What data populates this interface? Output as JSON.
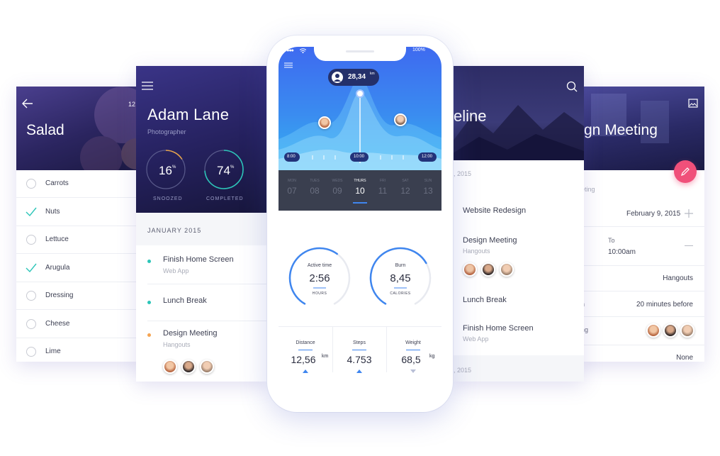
{
  "salad": {
    "title": "Salad",
    "header_number": "12",
    "items": [
      {
        "label": "Carrots",
        "checked": false
      },
      {
        "label": "Nuts",
        "checked": true
      },
      {
        "label": "Lettuce",
        "checked": false
      },
      {
        "label": "Arugula",
        "checked": true
      },
      {
        "label": "Dressing",
        "checked": false
      },
      {
        "label": "Cheese",
        "checked": false
      },
      {
        "label": "Lime",
        "checked": false
      }
    ]
  },
  "profile": {
    "name": "Adam Lane",
    "role": "Photographer",
    "stats": [
      {
        "value": "16",
        "unit": "%",
        "label": "SNOOZED",
        "fraction": 0.16
      },
      {
        "value": "74",
        "unit": "%",
        "label": "COMPLETED",
        "fraction": 0.74
      }
    ],
    "month": "JANUARY 2015",
    "events": [
      {
        "title": "Finish Home Screen",
        "subtitle": "Web App",
        "color": "#2cc5b8"
      },
      {
        "title": "Lunch Break",
        "subtitle": "",
        "color": "#2cc5b8"
      },
      {
        "title": "Design Meeting",
        "subtitle": "Hangouts",
        "color": "#f5a452"
      }
    ]
  },
  "phone": {
    "status": {
      "battery": "100%"
    },
    "tooltip": {
      "value": "28,34",
      "unit": "km"
    },
    "time_axis": [
      "8:00",
      "10:00",
      "12:00"
    ],
    "days": [
      {
        "name": "MON",
        "num": "07"
      },
      {
        "name": "TUES",
        "num": "08"
      },
      {
        "name": "WEDS",
        "num": "09"
      },
      {
        "name": "THURS",
        "num": "10",
        "active": true
      },
      {
        "name": "FRI",
        "num": "11"
      },
      {
        "name": "SAT",
        "num": "12"
      },
      {
        "name": "SUN",
        "num": "13"
      }
    ],
    "rings": [
      {
        "label": "Active time",
        "value": "2:56",
        "unit": "HOURS",
        "fraction": 0.62
      },
      {
        "label": "Burn",
        "value": "8,45",
        "unit": "CALORIES",
        "fraction": 0.7
      }
    ],
    "metrics": [
      {
        "label": "Distance",
        "value": "12,56",
        "unit": "km",
        "trend": "up"
      },
      {
        "label": "Steps",
        "value": "4.753",
        "unit": "",
        "trend": "up"
      },
      {
        "label": "Weight",
        "value": "68,5",
        "unit": "kg",
        "trend": "down"
      }
    ]
  },
  "timeline": {
    "title_fragment": "eline",
    "month_top": ", 2015",
    "items": [
      {
        "title": "Website Redesign",
        "subtitle": ""
      },
      {
        "title": "Design Meeting",
        "subtitle": "Hangouts"
      },
      {
        "title": "Lunch Break",
        "subtitle": ""
      },
      {
        "title": "Finish Home Screen",
        "subtitle": "Web App"
      }
    ],
    "month_bottom": ", 2015"
  },
  "meeting": {
    "title_fragment": "gn Meeting",
    "section_label": "eting",
    "date": "February 9, 2015",
    "to_label": "To",
    "to_time": "10:00am",
    "location": "Hangouts",
    "reminder_label": "n",
    "reminder": "20 minutes before",
    "guests_label": "ng",
    "repeat": "None"
  },
  "colors": {
    "accent_blue": "#3f86ef",
    "teal": "#2cc5b8",
    "orange": "#f5a452",
    "pink": "#f0507a",
    "header_dark": "#1d2052"
  }
}
